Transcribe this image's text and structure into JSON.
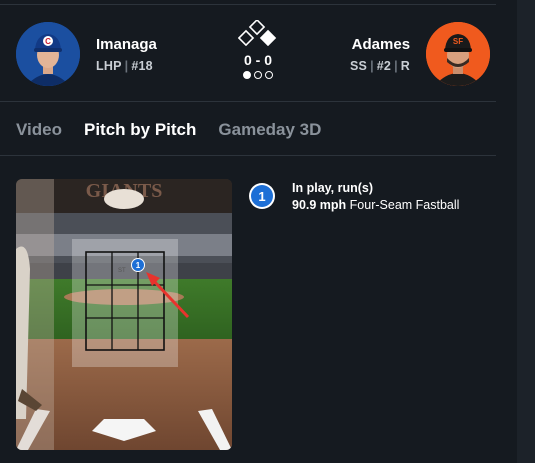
{
  "away_player": {
    "name": "Imanaga",
    "position": "LHP",
    "number": "#18",
    "team_logo": "C"
  },
  "home_player": {
    "name": "Adames",
    "position": "SS",
    "number": "#2",
    "bats": "R"
  },
  "count": {
    "score": "0 - 0",
    "bases": {
      "first": true,
      "second": false,
      "third": false
    },
    "outs": [
      true,
      false,
      false
    ]
  },
  "tabs": [
    {
      "label": "Video",
      "active": false
    },
    {
      "label": "Pitch by Pitch",
      "active": true
    },
    {
      "label": "Gameday 3D",
      "active": false
    }
  ],
  "pitch": {
    "number": "1",
    "result": "In play, run(s)",
    "speed": "90.9 mph",
    "type": "Four-Seam Fastball",
    "zone_marker": "1",
    "zone_label": "ST"
  },
  "colors": {
    "accent_blue": "#1d6fd6",
    "cubs_blue": "#1b4fa0",
    "giants_orange": "#f05a1e",
    "arrow_red": "#e8332d"
  }
}
